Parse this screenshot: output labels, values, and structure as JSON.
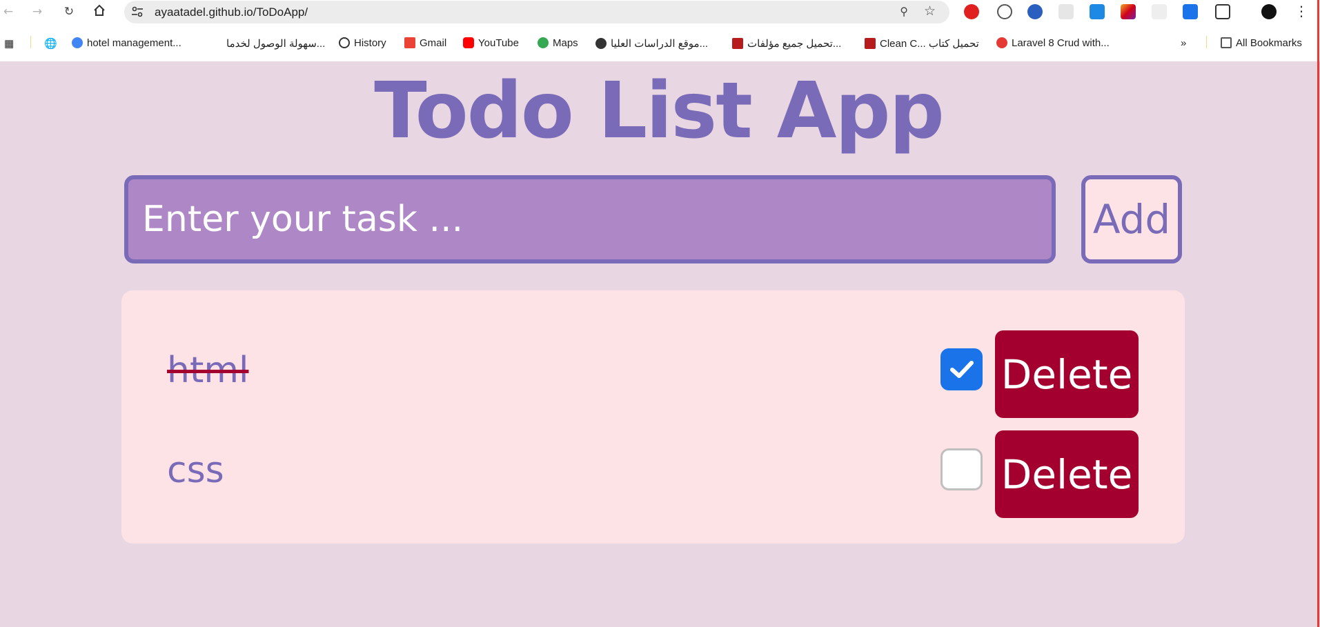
{
  "browser": {
    "url": "ayaatadel.github.io/ToDoApp/",
    "bookmarks": [
      "hotel management...",
      "سهولة الوصول لخدما...",
      "History",
      "Gmail",
      "YouTube",
      "Maps",
      "موقع الدراسات العليا...",
      "تحميل جميع مؤلفات...",
      "Clean C... تحميل كتاب",
      "Laravel 8 Crud with..."
    ],
    "all_bookmarks": "All Bookmarks",
    "overflow": "»"
  },
  "app": {
    "title": "Todo List App",
    "input": {
      "placeholder": "Enter your task ...",
      "value": ""
    },
    "add_label": "Add",
    "tasks": [
      {
        "text": "html",
        "completed": true,
        "delete_label": "Delete"
      },
      {
        "text": "css",
        "completed": false,
        "delete_label": "Delete"
      }
    ]
  },
  "colors": {
    "background": "#e8d6e2",
    "accent": "#7a6bb8",
    "input_fill": "#ad87c6",
    "card": "#fde3e5",
    "delete": "#a3002f",
    "checkbox_on": "#1a73e8"
  }
}
